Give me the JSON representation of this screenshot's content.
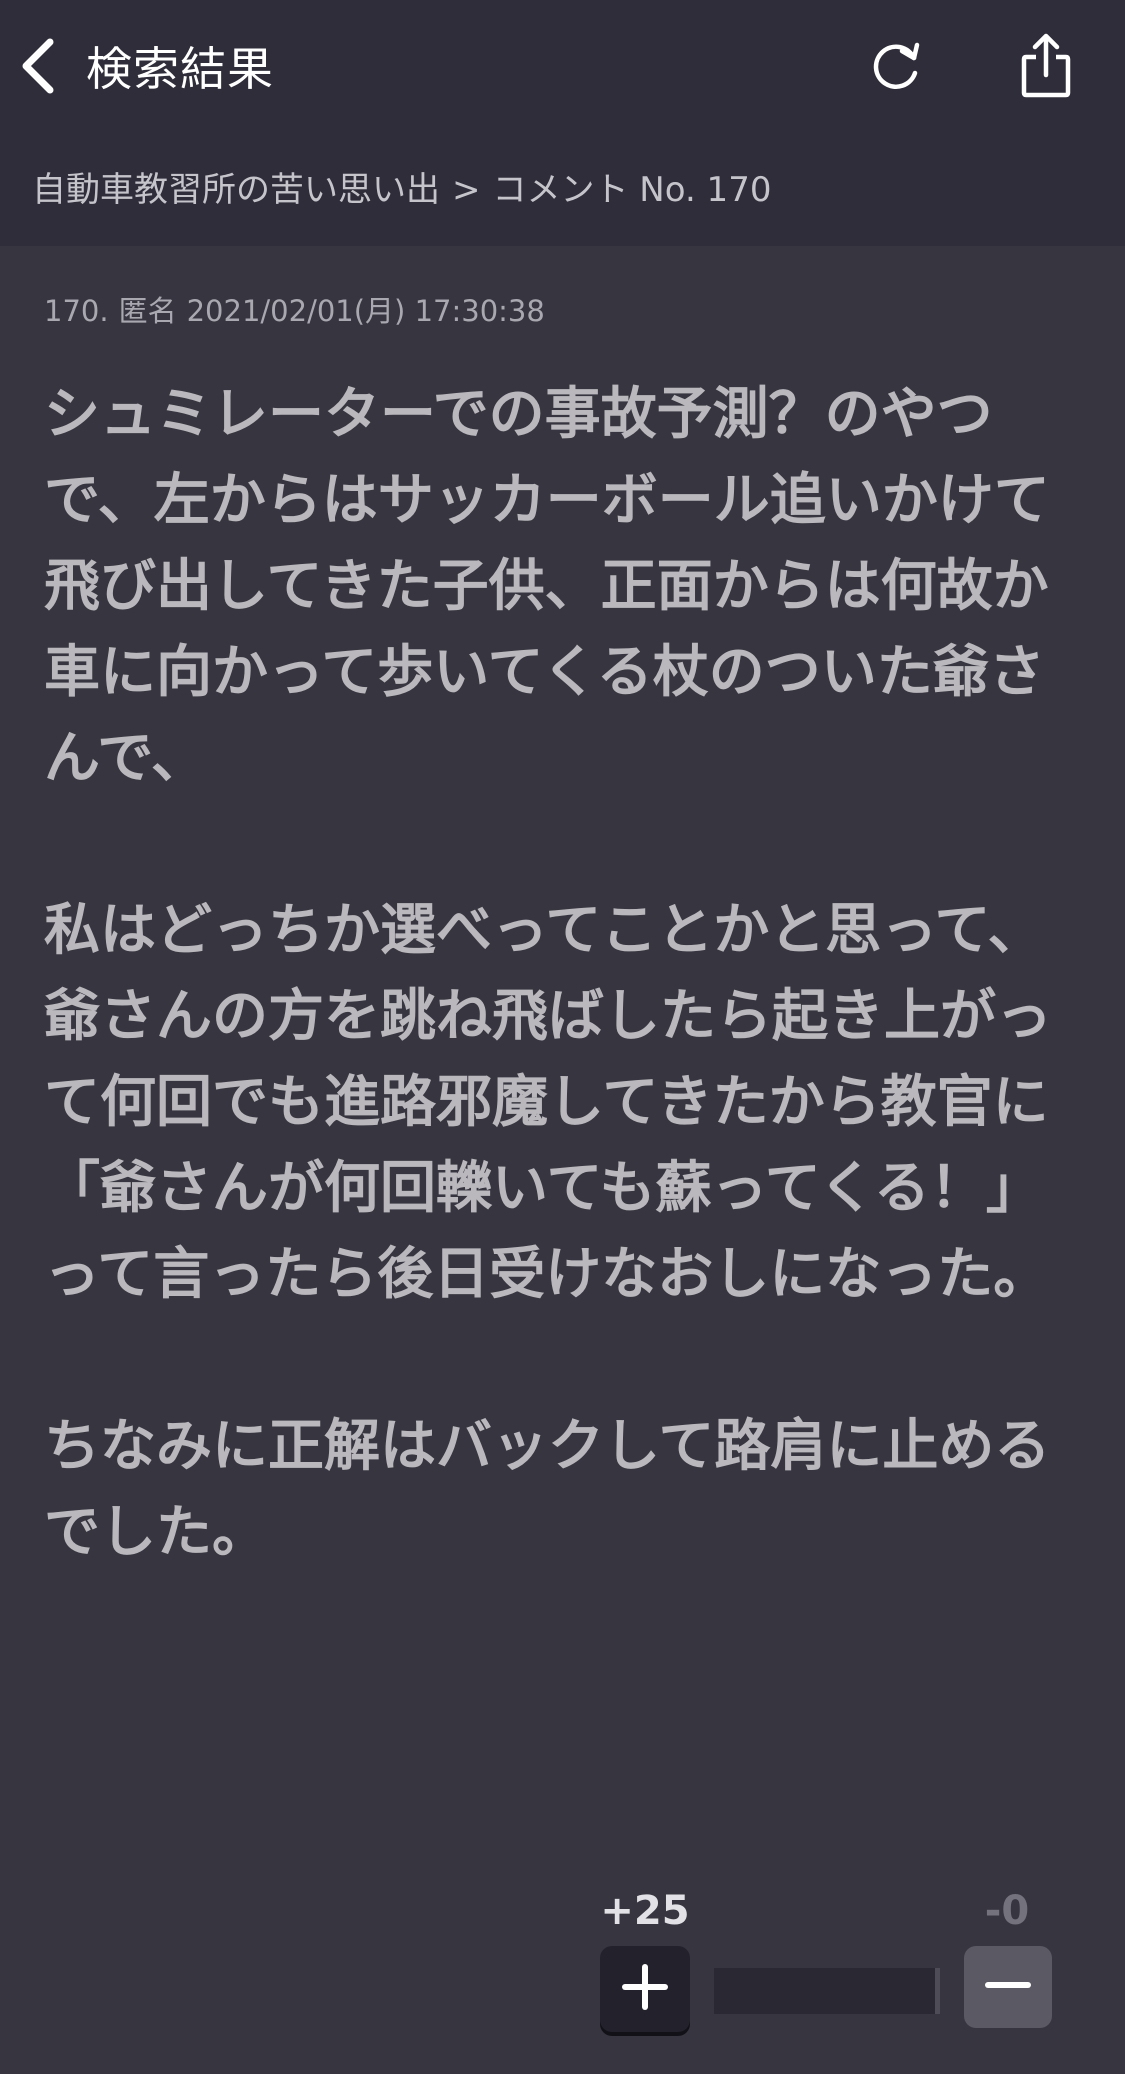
{
  "nav": {
    "back_label": "検索結果",
    "back_icon": "chevron-left-icon",
    "reload_icon": "reload-icon",
    "share_icon": "share-icon"
  },
  "breadcrumb": {
    "topic": "自動車教習所の苦い思い出",
    "separator": ">",
    "current": "コメント No. 170"
  },
  "comment": {
    "number": "170.",
    "author": "匿名",
    "date": "2021/02/01(月) 17:30:38",
    "body": "シュミレーターでの事故予測？のやつで、左からはサッカーボール追いかけて飛び出してきた子供、正面からは何故か車に向かって歩いてくる杖のついた爺さんで、\n\n私はどっちか選べってことかと思って、爺さんの方を跳ね飛ばしたら起き上がって何回でも進路邪魔してきたから教官に「爺さんが何回轢いても蘇ってくる！」って言ったら後日受けなおしになった。\n\nちなみに正解はバックして路肩に止めるでした。"
  },
  "votes": {
    "plus_count": "+25",
    "minus_count": "-0",
    "plus_ratio": 1.0,
    "plus_icon": "plus-icon",
    "minus_icon": "minus-icon"
  },
  "colors": {
    "header_bg": "#2e2d39",
    "page_bg": "#37353f",
    "text": "#bab8bd",
    "meta_text": "#a9a7b0"
  }
}
